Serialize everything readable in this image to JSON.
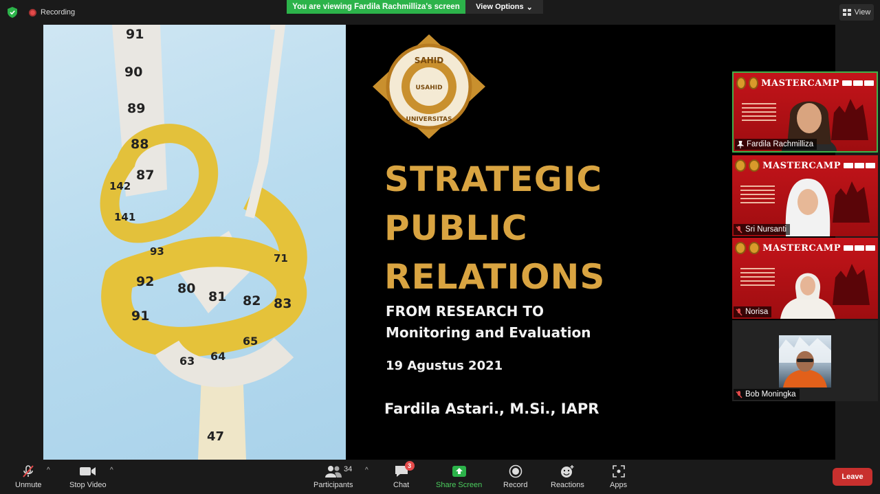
{
  "topbar": {
    "recording_label": "Recording",
    "viewing_banner": "You are viewing Fardila Rachmilliza's screen",
    "view_options_label": "View Options",
    "view_button_label": "View"
  },
  "slide": {
    "logo_text_top": "SAHID",
    "logo_text_center": "USAHID",
    "logo_text_bottom": "UNIVERSITAS",
    "title_lines": [
      "STRATEGIC",
      "PUBLIC",
      "RELATIONS"
    ],
    "subtitle_lines": [
      "FROM RESEARCH TO",
      "Monitoring and Evaluation"
    ],
    "date": "19 Agustus 2021",
    "author": "Fardila Astari., M.Si., IAPR",
    "tape_numbers": [
      "91",
      "90",
      "89",
      "88",
      "87",
      "142",
      "141",
      "93",
      "92",
      "91",
      "80",
      "81",
      "82",
      "83",
      "71",
      "63",
      "64",
      "65",
      "47"
    ]
  },
  "participants": [
    {
      "name": "Fardila Rachmilliza",
      "active": true,
      "muted": false,
      "banner": "MASTERCAMP",
      "banner_small": "COMMUNICATIONS"
    },
    {
      "name": "Sri Nursanti",
      "active": false,
      "muted": true,
      "banner": "MASTERCAMP",
      "banner_small": "COMMUNICATIONS",
      "caption": "ta, 19 Agustus 2021"
    },
    {
      "name": "Norisa",
      "active": false,
      "muted": true,
      "banner": "MASTERCAMP",
      "banner_small": "COMMUNICATIONS",
      "caption": "akarta, 19 Agustus 2021"
    },
    {
      "name": "Bob Moningka",
      "active": false,
      "muted": true
    }
  ],
  "toolbar": {
    "unmute_label": "Unmute",
    "stop_video_label": "Stop Video",
    "participants_label": "Participants",
    "participants_count": "34",
    "chat_label": "Chat",
    "chat_badge": "3",
    "share_screen_label": "Share Screen",
    "record_label": "Record",
    "reactions_label": "Reactions",
    "apps_label": "Apps",
    "leave_label": "Leave"
  },
  "colors": {
    "accent_green": "#2cb34a",
    "title_gold": "#d9a441",
    "leave_red": "#c8302e",
    "tile_red": "#c3141a"
  }
}
